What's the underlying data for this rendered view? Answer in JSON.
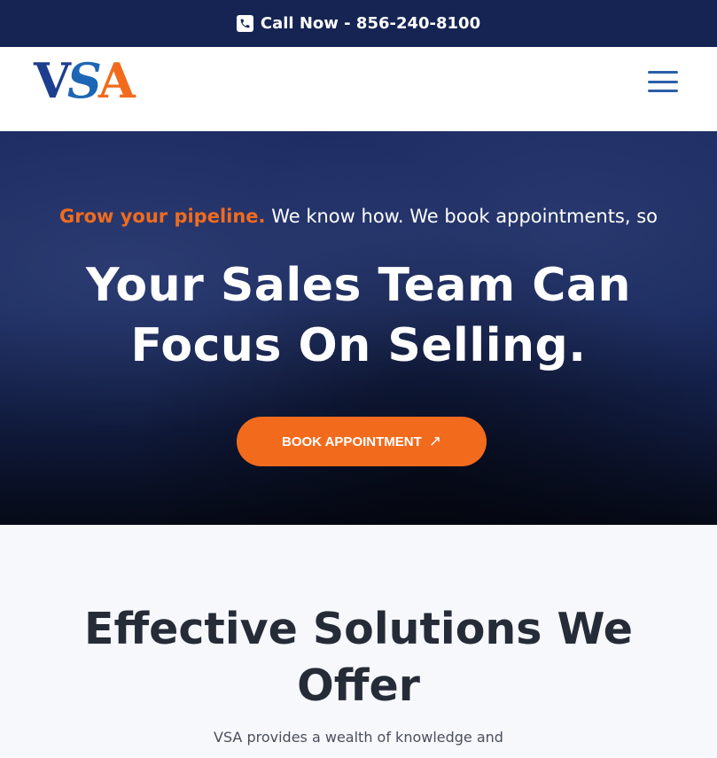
{
  "topbar": {
    "phone_icon": "phone-icon",
    "call_text": "Call Now - 856-240-8100"
  },
  "header": {
    "logo": {
      "v": "V",
      "s": "S",
      "a": "A"
    },
    "menu_icon": "hamburger-menu-icon"
  },
  "hero": {
    "tagline_accent": "Grow your pipeline.",
    "tagline_rest": " We know how. We book appointments, so",
    "title": "Your Sales Team Can Focus On Selling.",
    "cta_label": "BOOK APPOINTMENT",
    "cta_icon": "arrow-up-right-icon"
  },
  "solutions": {
    "title": "Effective Solutions We Offer",
    "text": "VSA provides a wealth of knowledge and"
  },
  "colors": {
    "topbar_bg": "#152453",
    "accent": "#f26b1d",
    "brand_blue": "#1d3d8f",
    "heading_dark": "#262b38"
  }
}
